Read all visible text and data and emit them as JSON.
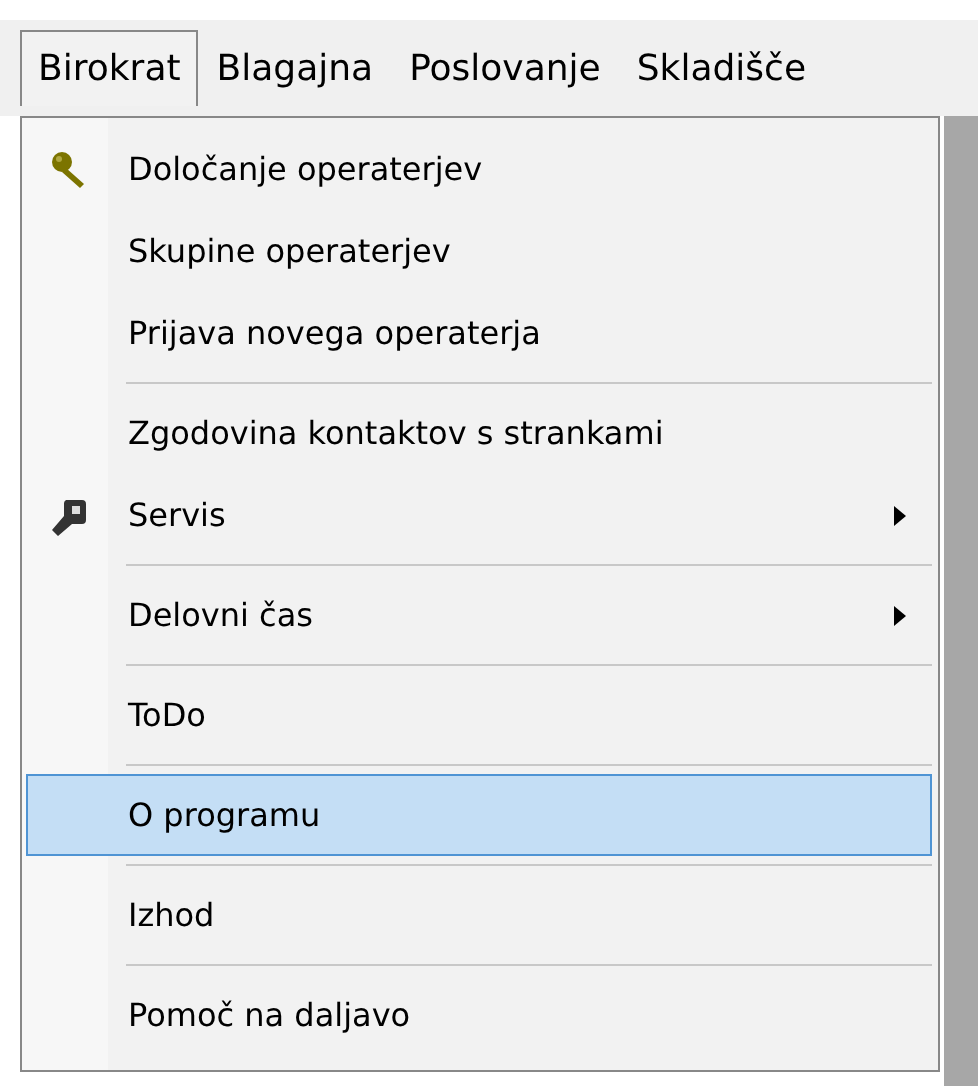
{
  "menubar": {
    "items": [
      {
        "label": "Birokrat",
        "selected": true
      },
      {
        "label": "Blagajna",
        "selected": false
      },
      {
        "label": "Poslovanje",
        "selected": false
      },
      {
        "label": "Skladišče",
        "selected": false
      }
    ]
  },
  "menu": {
    "items": [
      {
        "kind": "item",
        "label": "Določanje operaterjev",
        "submenu": false,
        "selected": false
      },
      {
        "kind": "item",
        "label": "Skupine operaterjev",
        "submenu": false,
        "selected": false
      },
      {
        "kind": "item",
        "label": "Prijava novega operaterja",
        "submenu": false,
        "selected": false
      },
      {
        "kind": "separator"
      },
      {
        "kind": "item",
        "label": "Zgodovina kontaktov s strankami",
        "submenu": false,
        "selected": false
      },
      {
        "kind": "item",
        "label": "Servis",
        "submenu": true,
        "selected": false
      },
      {
        "kind": "separator"
      },
      {
        "kind": "item",
        "label": "Delovni čas",
        "submenu": true,
        "selected": false
      },
      {
        "kind": "separator"
      },
      {
        "kind": "item",
        "label": "ToDo",
        "submenu": false,
        "selected": false
      },
      {
        "kind": "separator"
      },
      {
        "kind": "item",
        "label": "O programu",
        "submenu": false,
        "selected": true
      },
      {
        "kind": "separator"
      },
      {
        "kind": "item",
        "label": "Izhod",
        "submenu": false,
        "selected": false
      },
      {
        "kind": "separator"
      },
      {
        "kind": "item",
        "label": "Pomoč na daljavo",
        "submenu": false,
        "selected": false
      }
    ]
  }
}
